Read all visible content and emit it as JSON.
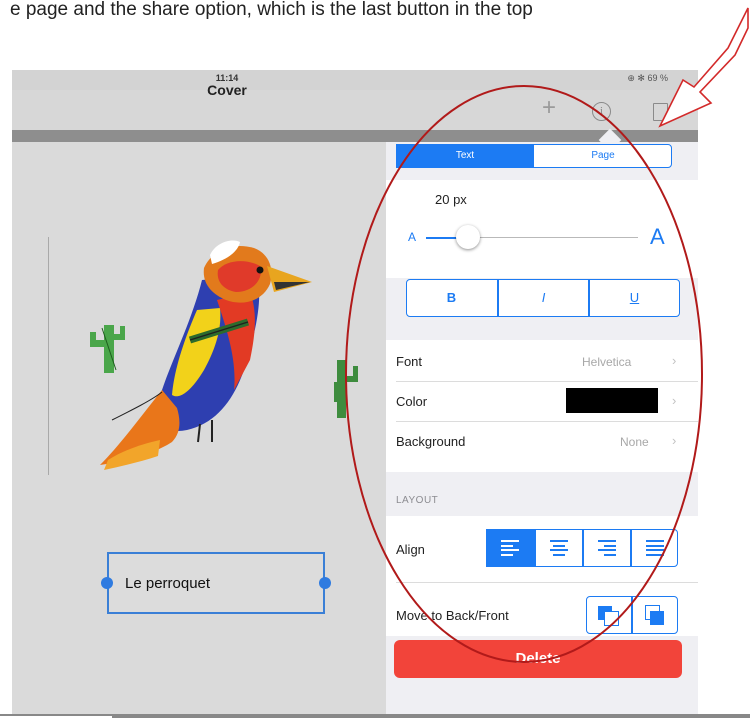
{
  "caption": "e page and the share option, which is the last button in the top",
  "status": {
    "time": "11:14",
    "right": "⊕ ✻ 69 %"
  },
  "nav": {
    "title": "Cover",
    "plus_label": "+",
    "info_label": "i"
  },
  "canvas": {
    "text_box_label": "Le perroquet"
  },
  "panel": {
    "tabs": [
      "Text",
      "Page"
    ],
    "font_size": "20 px",
    "font_size_fraction": 0.16,
    "size_small_label": "A",
    "size_large_label": "A",
    "style_buttons": [
      "B",
      "I",
      "U"
    ],
    "rows": [
      {
        "label": "Font",
        "value": "Helvetica"
      },
      {
        "label": "Color",
        "value": "#000000"
      },
      {
        "label": "Background",
        "value": "None"
      }
    ],
    "layout_header": "LAYOUT",
    "align_label": "Align",
    "align_selected": "left",
    "move_label": "Move to Back/Front",
    "delete_label": "Delete"
  },
  "colors": {
    "accent": "#1c7bf3",
    "delete": "#f2443a",
    "annotation": "#b11a1a",
    "arrow": "#d32a2a"
  },
  "icons": [
    "plus-icon",
    "info-icon",
    "share-icon",
    "chevron-right-icon",
    "align-left-icon",
    "align-center-icon",
    "align-right-icon",
    "align-justify-icon",
    "send-to-back-icon",
    "bring-to-front-icon"
  ]
}
